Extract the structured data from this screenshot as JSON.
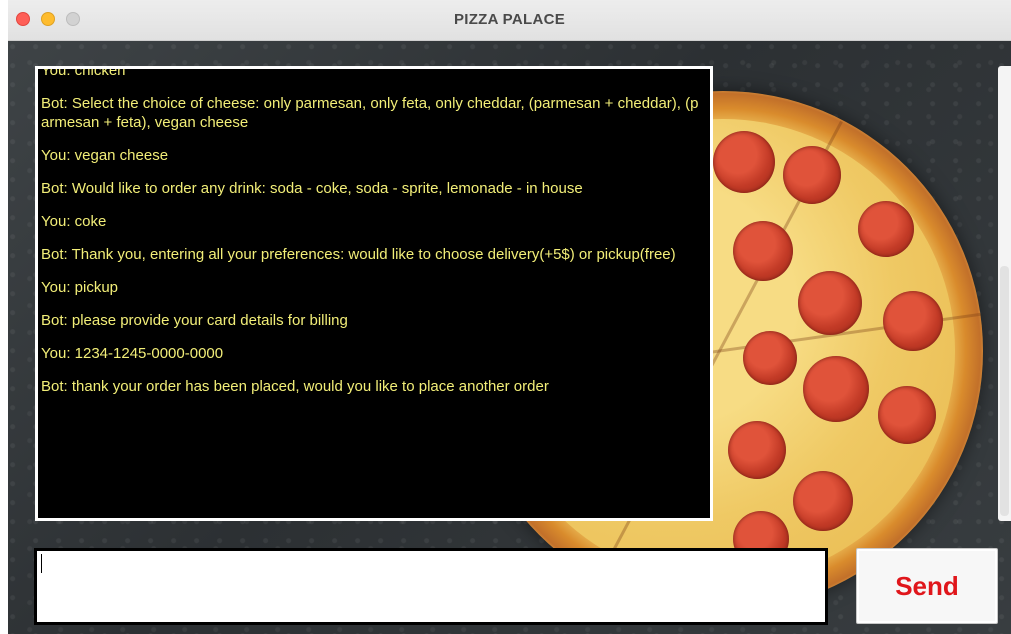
{
  "window": {
    "title": "PIZZA PALACE"
  },
  "chat": {
    "messages": [
      "You: chicken",
      "Bot: Select the choice of cheese: only parmesan, only feta, only cheddar, (parmesan + cheddar), (parmesan + feta), vegan cheese",
      "You: vegan cheese",
      "Bot: Would like to order any drink: soda - coke, soda - sprite, lemonade - in house",
      "You: coke",
      "Bot: Thank you, entering all your preferences: would like to choose delivery(+5$) or pickup(free)",
      "You: pickup",
      "Bot: please provide your card details for billing",
      "You: 1234-1245-0000-0000",
      "Bot: thank your order has been placed, would you like to place another order"
    ]
  },
  "composer": {
    "input_value": "",
    "send_label": "Send"
  },
  "colors": {
    "chat_text": "#f2ee78",
    "chat_background": "#000000",
    "send_text": "#e0161b"
  }
}
